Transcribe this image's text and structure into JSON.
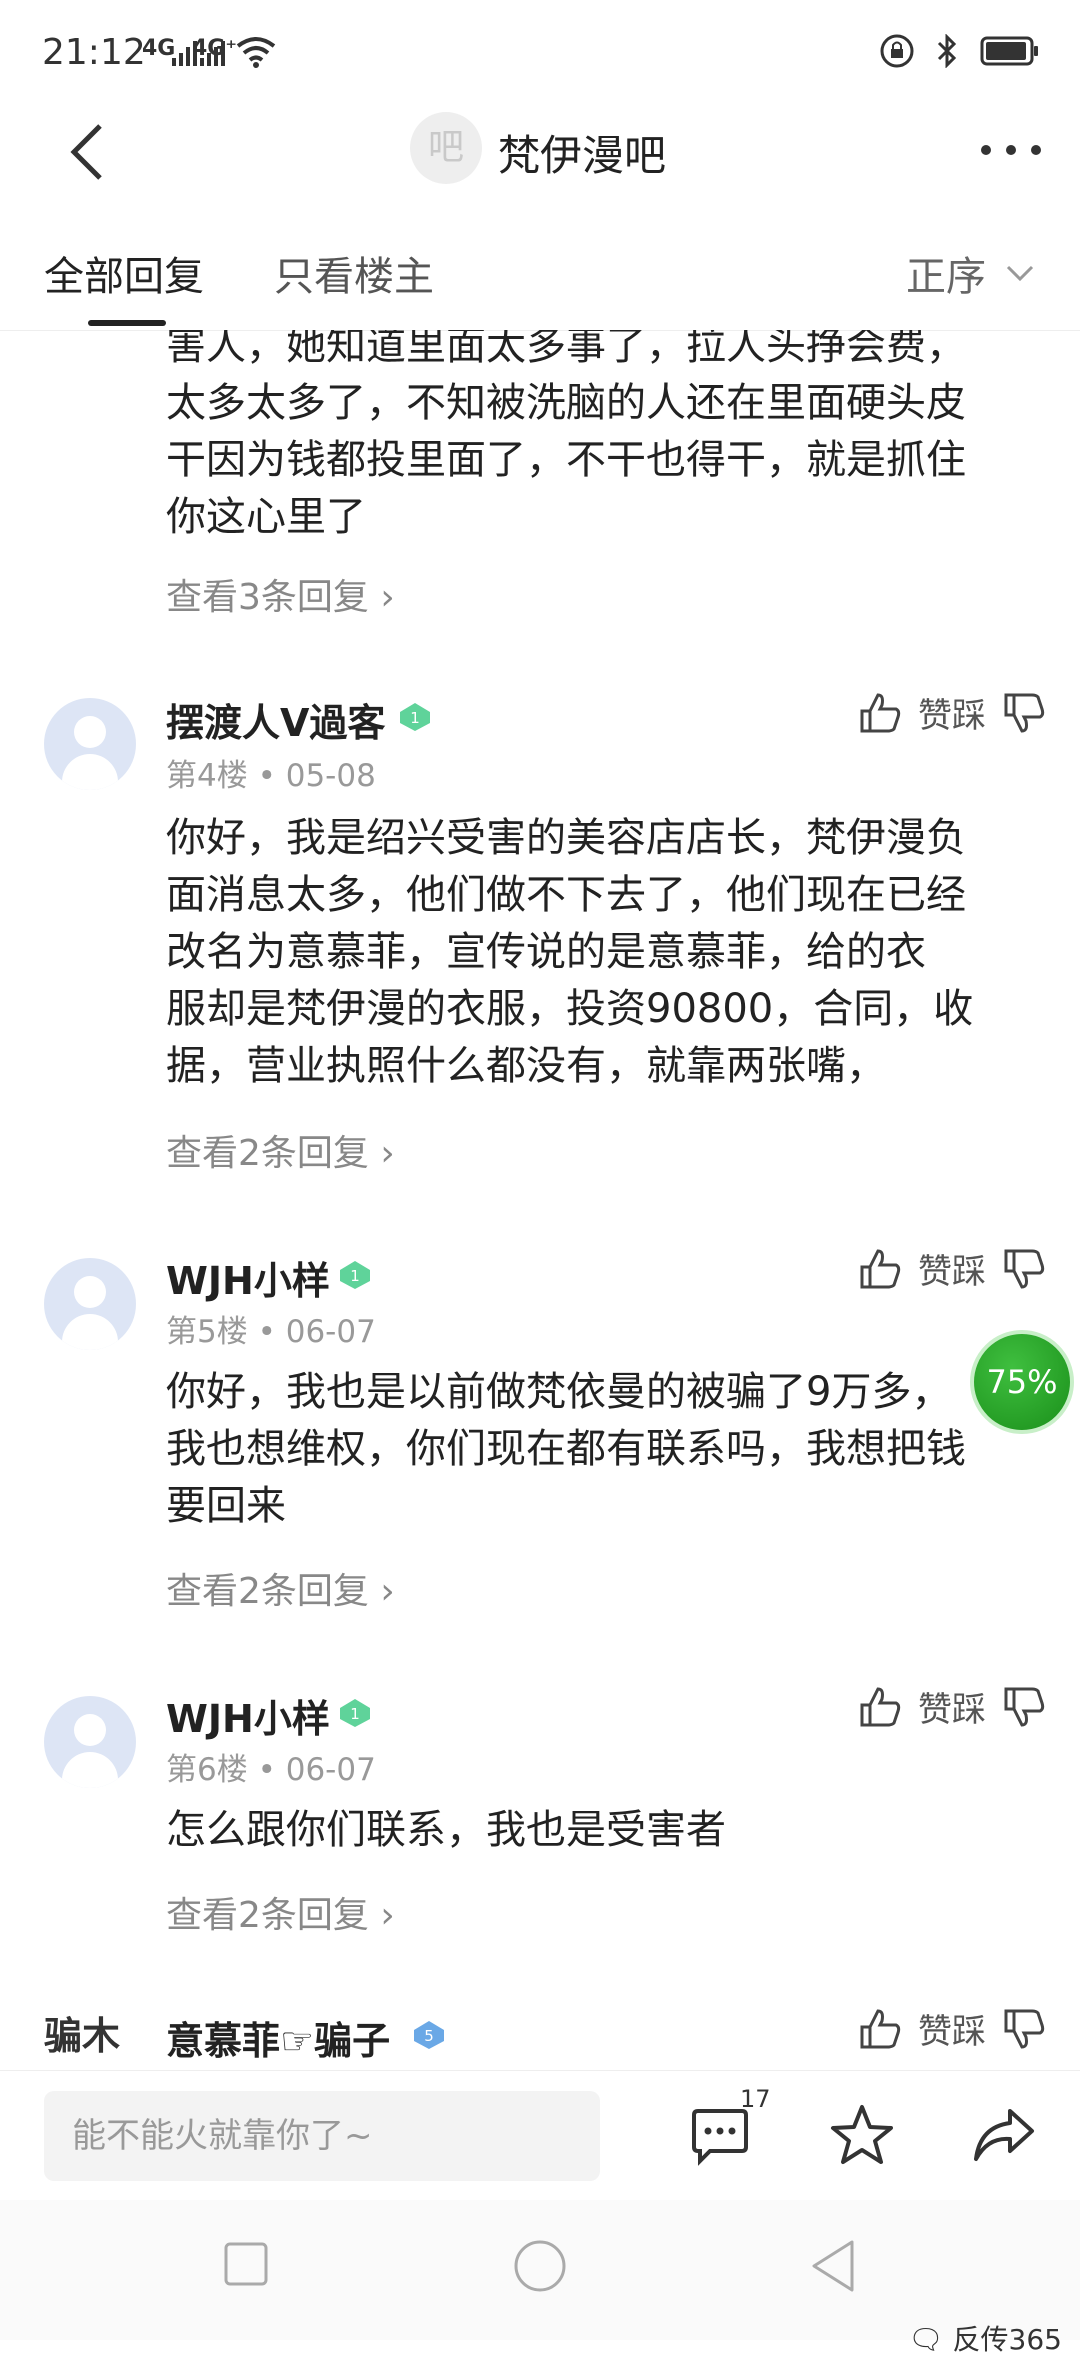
{
  "status": {
    "time": "21:12",
    "sig1": "4G",
    "sig2": "4G⁺"
  },
  "nav": {
    "logo": "吧",
    "title": "梵伊漫吧"
  },
  "tabs": {
    "all": "全部回复",
    "owner": "只看楼主",
    "sort": "正序"
  },
  "top_post": {
    "lines": [
      "害人，她知道里面太多事了，拉人头挣会费，",
      "太多太多了，不知被洗脑的人还在里面硬头皮",
      "干因为钱都投里面了，不干也得干，就是抓住",
      "你这心里了"
    ],
    "replies": "查看3条回复"
  },
  "posts": [
    {
      "author": "摆渡人V過客",
      "badge_level": "1",
      "floor": "第4楼",
      "date": "05-08",
      "like_label": "赞踩",
      "lines": [
        "你好，我是绍兴受害的美容店店长，梵伊漫负",
        "面消息太多，他们做不下去了，他们现在已经",
        "改名为意慕菲，宣传说的是意慕菲，给的衣",
        "服却是梵伊漫的衣服，投资90800，合同，收",
        "据，营业执照什么都没有，就靠两张嘴，"
      ],
      "replies": "查看2条回复"
    },
    {
      "author": "WJH小样",
      "badge_level": "1",
      "floor": "第5楼",
      "date": "06-07",
      "like_label": "赞踩",
      "lines": [
        "你好，我也是以前做梵依曼的被骗了9万多，",
        "我也想维权，你们现在都有联系吗，我想把钱",
        "要回来"
      ],
      "replies": "查看2条回复"
    },
    {
      "author": "WJH小样",
      "badge_level": "1",
      "floor": "第6楼",
      "date": "06-07",
      "like_label": "赞踩",
      "lines": [
        "怎么跟你们联系，我也是受害者"
      ],
      "replies": "查看2条回复"
    },
    {
      "author": "意慕菲☞骗子",
      "badge_level": "5",
      "avatar_text": "骗木",
      "like_label": "赞踩"
    }
  ],
  "floating": "75%",
  "input": {
    "placeholder": "能不能火就靠你了~",
    "comment_count": "17"
  },
  "watermark": "反传365",
  "colors": {
    "badge_green": "#5fd39a",
    "badge_blue": "#6aa8e6",
    "floating_green": "#2aa52a"
  }
}
